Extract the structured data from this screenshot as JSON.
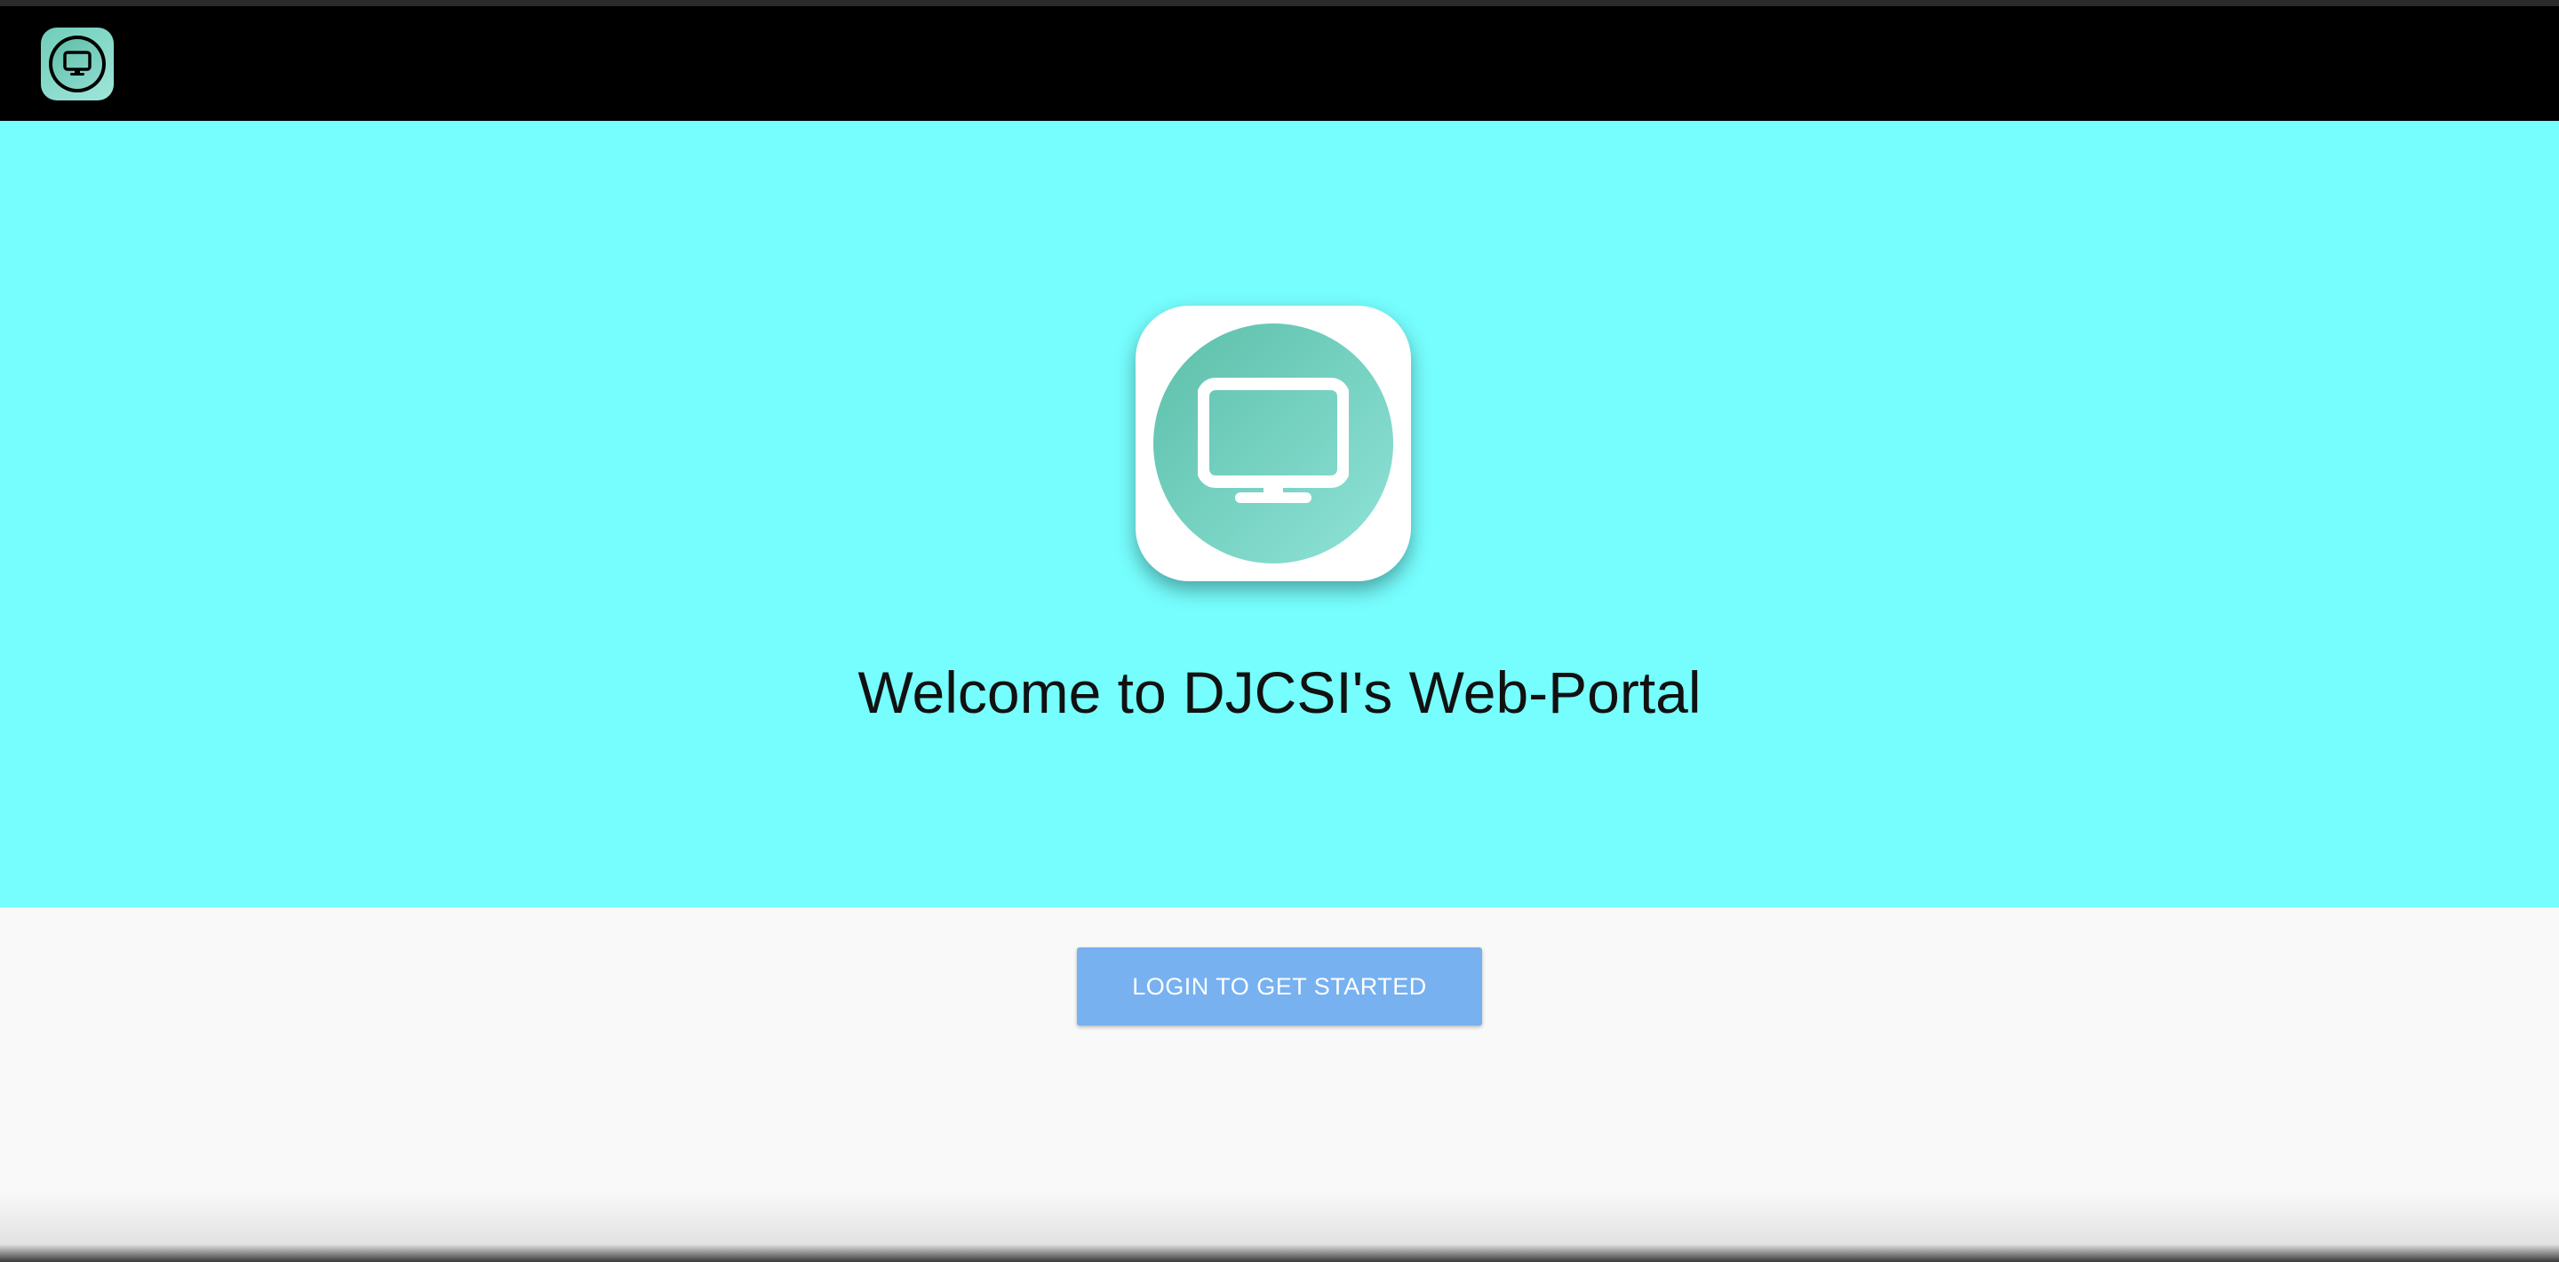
{
  "navbar": {
    "logo_icon": "monitor-icon",
    "background_color": "#000000"
  },
  "hero": {
    "background_color": "#76fdfd",
    "logo_icon": "monitor-icon",
    "title": "Welcome to DJCSI's Web-Portal"
  },
  "actions": {
    "login_label": "LOGIN TO GET STARTED",
    "login_color": "#77b1f0"
  }
}
